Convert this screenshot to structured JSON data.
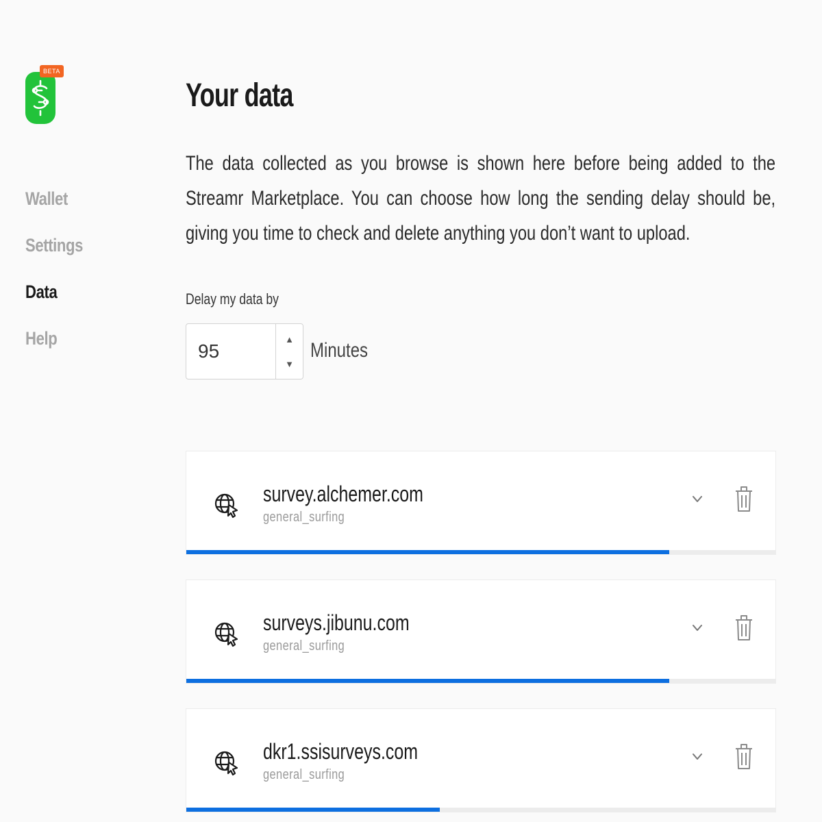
{
  "sidebar": {
    "beta_badge": "BETA",
    "nav": [
      {
        "label": "Wallet",
        "active": false
      },
      {
        "label": "Settings",
        "active": false
      },
      {
        "label": "Data",
        "active": true
      },
      {
        "label": "Help",
        "active": false
      }
    ]
  },
  "main": {
    "title": "Your data",
    "description": "The data collected as you browse is shown here before being added to the Streamr Marketplace. You can choose how long the sending delay should be, giving you time to check and delete anything you don’t want to upload.",
    "delay": {
      "label": "Delay my data by",
      "value": "95",
      "unit": "Minutes"
    },
    "items": [
      {
        "domain": "survey.alchemer.com",
        "category": "general_surfing",
        "progress": 0.82
      },
      {
        "domain": "surveys.jibunu.com",
        "category": "general_surfing",
        "progress": 0.82
      },
      {
        "domain": "dkr1.ssisurveys.com",
        "category": "general_surfing",
        "progress": 0.43
      }
    ]
  },
  "colors": {
    "brand_green": "#22c33a",
    "beta_orange": "#f26522",
    "progress_blue": "#0d6fe0",
    "nav_inactive": "#a5a5a5"
  },
  "icons": {
    "logo": "dollar-circuit-icon",
    "item": "globe-cursor-icon",
    "expand": "chevron-down-icon",
    "delete": "trash-icon",
    "step_up": "triangle-up-icon",
    "step_down": "triangle-down-icon"
  }
}
